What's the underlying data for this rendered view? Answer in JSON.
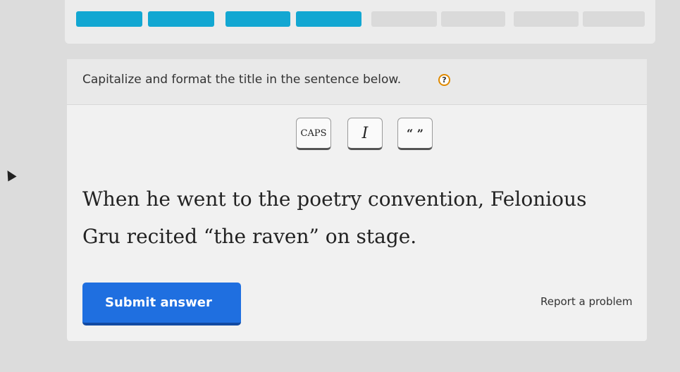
{
  "progress": {
    "total_segments": 8,
    "completed_segments": 4,
    "filled_color": "#12a7d2",
    "empty_color": "#dadada"
  },
  "question": {
    "prompt": "Capitalize and format the title in the sentence below.",
    "help_icon": "?"
  },
  "toolbar": {
    "caps_label": "CAPS",
    "italic_label": "I",
    "quotes_label": "“ ”"
  },
  "sentence": {
    "text": "When he went to the poetry convention, Felonious Gru recited “the raven” on stage."
  },
  "actions": {
    "submit_label": "Submit answer",
    "report_label": "Report a problem",
    "submit_color": "#1f6fe0"
  }
}
